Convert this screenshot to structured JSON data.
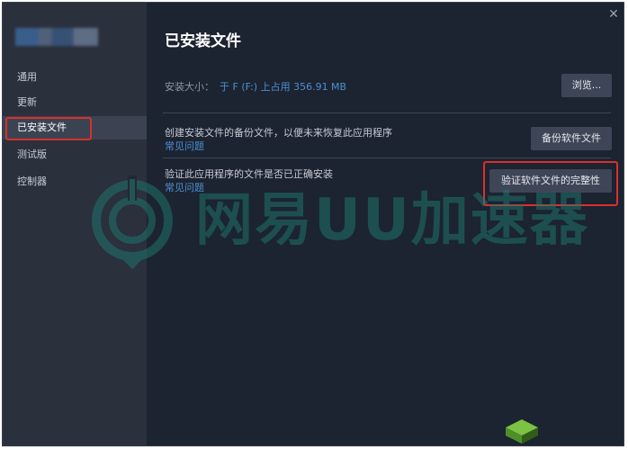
{
  "window": {
    "close_glyph": "✕"
  },
  "sidebar": {
    "items": [
      {
        "label": "通用"
      },
      {
        "label": "更新"
      },
      {
        "label": "已安装文件",
        "active": true
      },
      {
        "label": "测试版"
      },
      {
        "label": "控制器"
      }
    ]
  },
  "main": {
    "title": "已安装文件",
    "install_size_label": "安装大小：",
    "install_size_value": "于 F (F:) 上占用 356.91 MB",
    "browse_button": "浏览...",
    "backup": {
      "text": "创建安装文件的备份文件，以便未来恢复此应用程序",
      "faq": "常见问题",
      "button": "备份软件文件"
    },
    "verify": {
      "text": "验证此应用程序的文件是否已正确安装",
      "faq": "常见问题",
      "button": "验证软件文件的完整性"
    }
  },
  "watermark": {
    "text": "网易UU加速器"
  },
  "colors": {
    "window_bg": "#1c2331",
    "sidebar_bg": "#2a303c",
    "button_bg": "#3d4556",
    "link": "#4c8fd1",
    "highlight_red": "#d9302a",
    "watermark_teal": "#1f7a70"
  }
}
